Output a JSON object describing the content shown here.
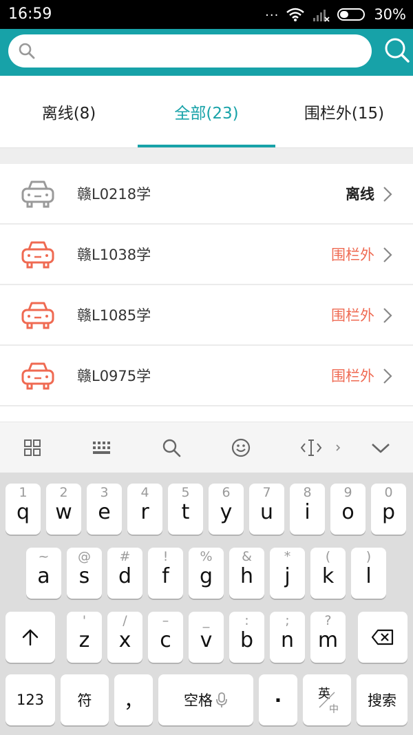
{
  "status_bar": {
    "time": "16:59",
    "dots": "...",
    "battery": "30%"
  },
  "search": {
    "placeholder": "",
    "value": ""
  },
  "tabs": [
    {
      "label": "离线(8)"
    },
    {
      "label": "全部(23)"
    },
    {
      "label": "围栏外(15)"
    }
  ],
  "vehicles": [
    {
      "plate": "赣L0218学",
      "status": "离线"
    },
    {
      "plate": "赣L1038学",
      "status": "围栏外"
    },
    {
      "plate": "赣L1085学",
      "status": "围栏外"
    },
    {
      "plate": "赣L0975学",
      "status": "围栏外"
    }
  ],
  "keyboard": {
    "row1": [
      {
        "hint": "1",
        "key": "q"
      },
      {
        "hint": "2",
        "key": "w"
      },
      {
        "hint": "3",
        "key": "e"
      },
      {
        "hint": "4",
        "key": "r"
      },
      {
        "hint": "5",
        "key": "t"
      },
      {
        "hint": "6",
        "key": "y"
      },
      {
        "hint": "7",
        "key": "u"
      },
      {
        "hint": "8",
        "key": "i"
      },
      {
        "hint": "9",
        "key": "o"
      },
      {
        "hint": "0",
        "key": "p"
      }
    ],
    "row2": [
      {
        "hint": "~",
        "key": "a"
      },
      {
        "hint": "@",
        "key": "s"
      },
      {
        "hint": "#",
        "key": "d"
      },
      {
        "hint": "!",
        "key": "f"
      },
      {
        "hint": "%",
        "key": "g"
      },
      {
        "hint": "&",
        "key": "h"
      },
      {
        "hint": "*",
        "key": "j"
      },
      {
        "hint": "(",
        "key": "k"
      },
      {
        "hint": ")",
        "key": "l"
      }
    ],
    "row3": [
      {
        "hint": "'",
        "key": "z"
      },
      {
        "hint": "/",
        "key": "x"
      },
      {
        "hint": "–",
        "key": "c"
      },
      {
        "hint": "_",
        "key": "v"
      },
      {
        "hint": ":",
        "key": "b"
      },
      {
        "hint": ";",
        "key": "n"
      },
      {
        "hint": "?",
        "key": "m"
      }
    ],
    "num_label": "123",
    "symbol_label": "符",
    "comma_label": "，",
    "space_label": "空格",
    "period_label": "·",
    "lang_top": "英",
    "lang_bottom": "中",
    "search_label": "搜索"
  },
  "colors": {
    "accent": "#17a2a8",
    "outside": "#ef6a52",
    "offline_icon": "#9a9a9a"
  }
}
